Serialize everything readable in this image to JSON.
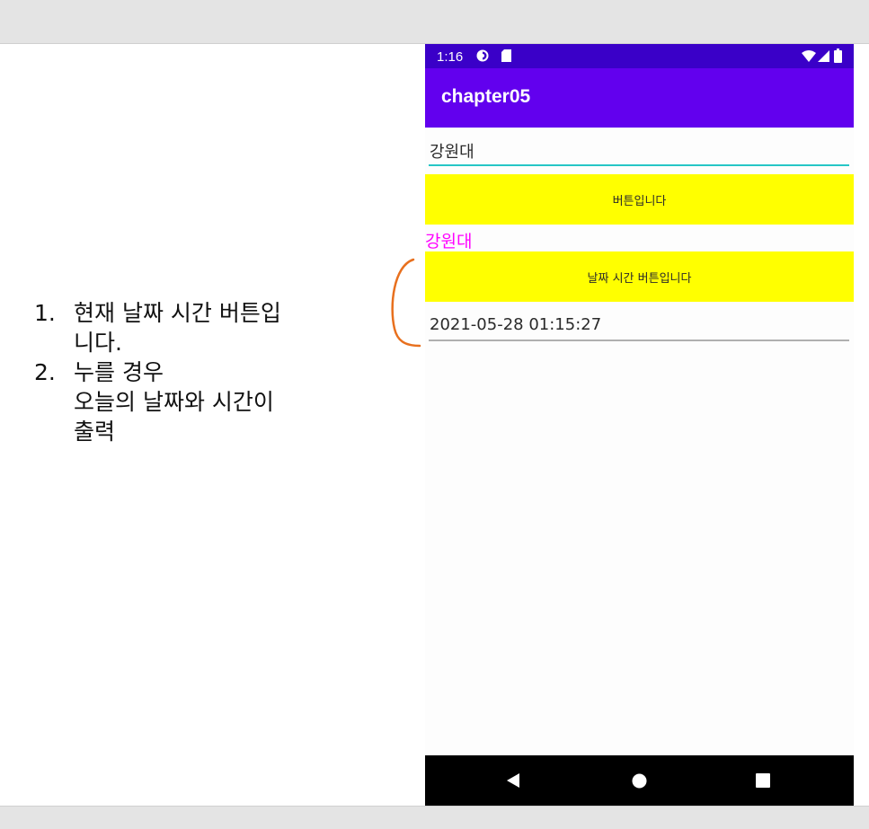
{
  "notes": {
    "items": [
      {
        "num": "1.",
        "text": "현재 날짜 시간 버튼입\n니다."
      },
      {
        "num": "2.",
        "text": "누를 경우\n오늘의 날짜와 시간이\n출력"
      }
    ]
  },
  "status_bar": {
    "time": "1:16",
    "icons": [
      "sync-icon",
      "sd-card-icon",
      "wifi-icon",
      "signal-icon",
      "battery-icon"
    ]
  },
  "app_bar": {
    "title": "chapter05"
  },
  "edit_text": {
    "value": "강원대"
  },
  "button_1": {
    "label": "버튼입니다"
  },
  "label_output": {
    "text": "강원대"
  },
  "button_2": {
    "label": "날짜 시간 버튼입니다"
  },
  "date_field": {
    "value": "2021-05-28 01:15:27"
  },
  "nav_bar": {
    "icons": [
      "back-icon",
      "home-icon",
      "recents-icon"
    ]
  },
  "colors": {
    "status_bar": "#3a00c8",
    "app_bar": "#6200ee",
    "button": "#ffff00",
    "label": "#ff00ff",
    "annotation": "#e8701e",
    "edit_underline": "#26c6c6"
  }
}
